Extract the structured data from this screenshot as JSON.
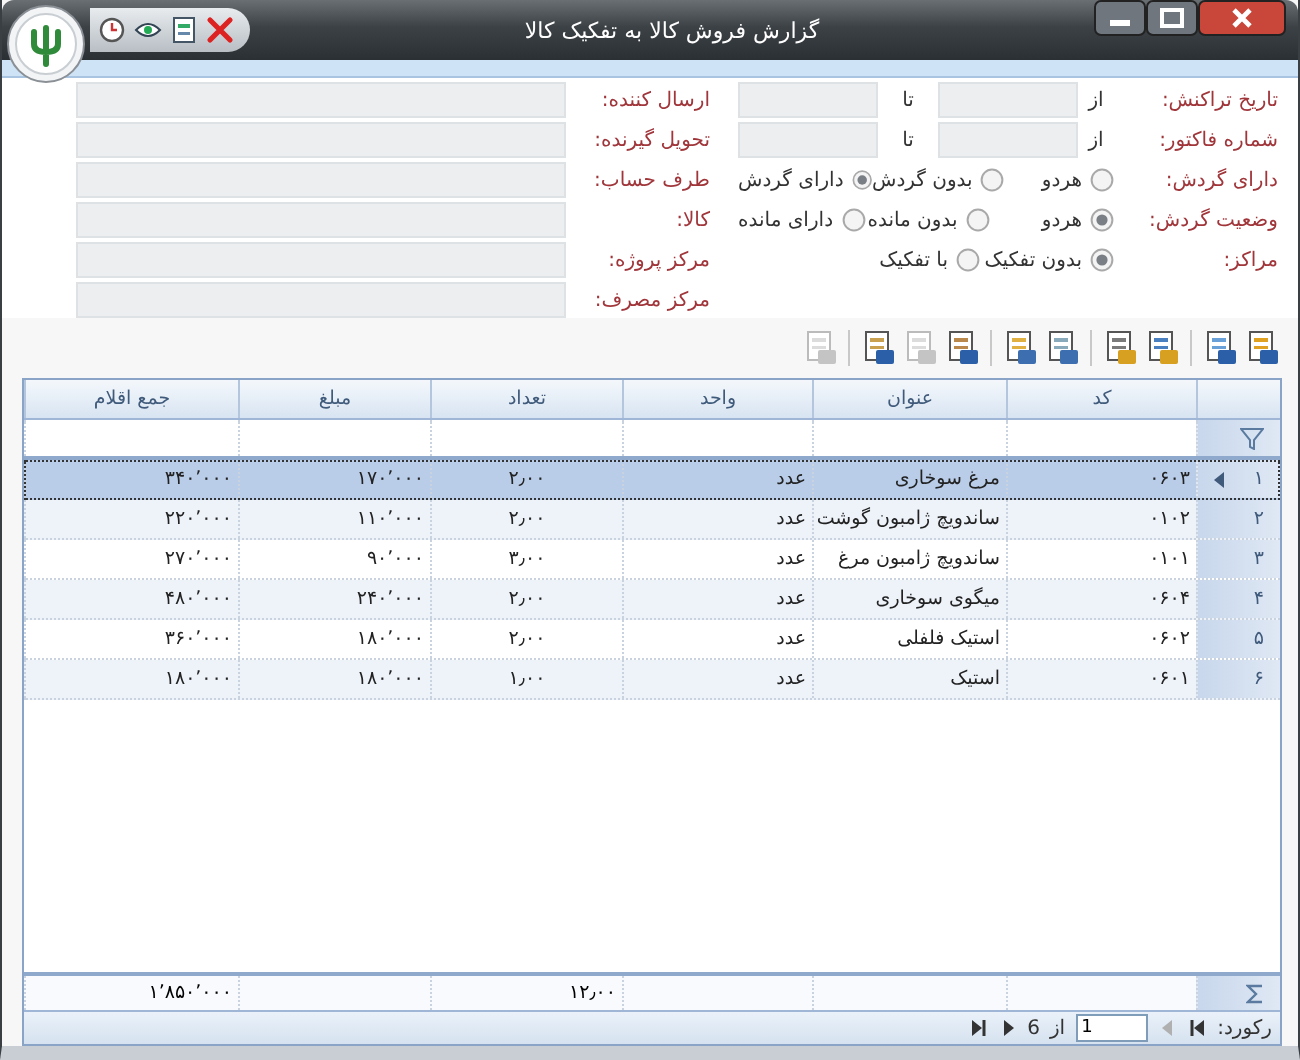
{
  "window": {
    "title": "گزارش فروش کالا به تفکیک کالا"
  },
  "filters": [
    {
      "kind": "range",
      "label": "تاریخ تراکنش:",
      "from_label": "از",
      "to_label": "تا"
    },
    {
      "kind": "range",
      "label": "شماره فاکتور:",
      "from_label": "از",
      "to_label": "تا"
    },
    {
      "kind": "radio",
      "label": "دارای گردش:",
      "options": [
        {
          "label": "هردو",
          "selected": false
        },
        {
          "label": "بدون گردش",
          "selected": false
        },
        {
          "label": "دارای گردش",
          "selected": true
        }
      ]
    },
    {
      "kind": "radio",
      "label": "وضعیت گردش:",
      "options": [
        {
          "label": "هردو",
          "selected": true
        },
        {
          "label": "بدون مانده",
          "selected": false
        },
        {
          "label": "دارای مانده",
          "selected": false
        }
      ]
    },
    {
      "kind": "radio",
      "label": "مراکز:",
      "options": [
        {
          "label": "بدون تفکیک",
          "selected": true
        },
        {
          "label": "با تفکیک",
          "selected": false
        }
      ]
    }
  ],
  "side_fields": [
    {
      "label": "ارسال کننده:"
    },
    {
      "label": "تحویل گیرنده:"
    },
    {
      "label": "طرف حساب:"
    },
    {
      "label": "کالا:"
    },
    {
      "label": "مرکز پروژه:"
    },
    {
      "label": "مرکز مصرف:"
    }
  ],
  "toolbar": {
    "groups": [
      [
        {
          "disabled": false
        },
        {
          "disabled": false
        }
      ],
      [
        {
          "disabled": false
        },
        {
          "disabled": false
        }
      ],
      [
        {
          "disabled": false
        },
        {
          "disabled": false
        }
      ],
      [
        {
          "disabled": false
        },
        {
          "disabled": true
        },
        {
          "disabled": false
        }
      ],
      [
        {
          "disabled": true
        }
      ]
    ]
  },
  "grid": {
    "columns": [
      "کد",
      "عنوان",
      "واحد",
      "تعداد",
      "مبلغ",
      "جمع اقلام"
    ],
    "rows": [
      {
        "number": "۱",
        "selected": true,
        "cells": [
          "۰۶۰۳",
          "مرغ سوخاری",
          "عدد",
          "۲٫۰۰",
          "۱۷۰٬۰۰۰",
          "۳۴۰٬۰۰۰"
        ]
      },
      {
        "number": "۲",
        "selected": false,
        "cells": [
          "۰۱۰۲",
          "ساندویچ ژامبون گوشت",
          "عدد",
          "۲٫۰۰",
          "۱۱۰٬۰۰۰",
          "۲۲۰٬۰۰۰"
        ]
      },
      {
        "number": "۳",
        "selected": false,
        "cells": [
          "۰۱۰۱",
          "ساندویچ ژامبون مرغ",
          "عدد",
          "۳٫۰۰",
          "۹۰٬۰۰۰",
          "۲۷۰٬۰۰۰"
        ]
      },
      {
        "number": "۴",
        "selected": false,
        "cells": [
          "۰۶۰۴",
          "میگوی سوخاری",
          "عدد",
          "۲٫۰۰",
          "۲۴۰٬۰۰۰",
          "۴۸۰٬۰۰۰"
        ]
      },
      {
        "number": "۵",
        "selected": false,
        "cells": [
          "۰۶۰۲",
          "استیک فلفلی",
          "عدد",
          "۲٫۰۰",
          "۱۸۰٬۰۰۰",
          "۳۶۰٬۰۰۰"
        ]
      },
      {
        "number": "۶",
        "selected": false,
        "cells": [
          "۰۶۰۱",
          "استیک",
          "عدد",
          "۱٫۰۰",
          "۱۸۰٬۰۰۰",
          "۱۸۰٬۰۰۰"
        ]
      }
    ],
    "totals": {
      "quantity": "۱۲٫۰۰",
      "amount": "۱٬۸۵۰٬۰۰۰"
    }
  },
  "record_nav": {
    "label": "رکورد:",
    "value": "1",
    "of_label": "از",
    "count": "6",
    "buttons": [
      {
        "kind": "first",
        "disabled": false
      },
      {
        "kind": "previous",
        "disabled": true
      },
      {
        "kind": "next",
        "disabled": false
      },
      {
        "kind": "last",
        "disabled": false
      }
    ]
  }
}
